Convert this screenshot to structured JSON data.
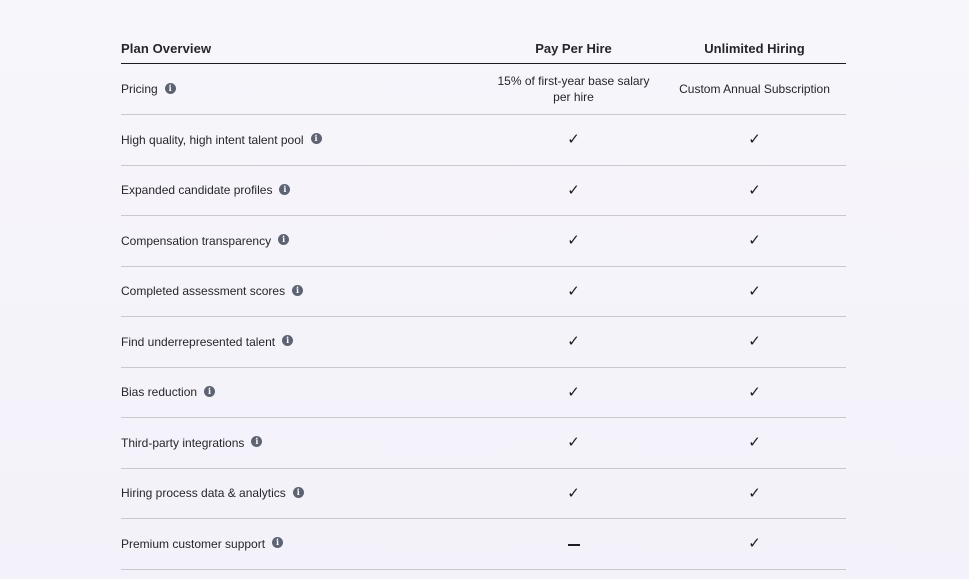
{
  "header": {
    "feature_label": "Plan Overview",
    "plan_a": "Pay Per Hire",
    "plan_b": "Unlimited Hiring"
  },
  "rows": [
    {
      "feature": "Pricing",
      "plan_a": "15% of first-year base salary per hire",
      "plan_b": "Custom Annual Subscription"
    },
    {
      "feature": "High quality, high intent talent pool",
      "plan_a": "✓",
      "plan_b": "✓"
    },
    {
      "feature": "Expanded candidate profiles",
      "plan_a": "✓",
      "plan_b": "✓"
    },
    {
      "feature": "Compensation transparency",
      "plan_a": "✓",
      "plan_b": "✓"
    },
    {
      "feature": "Completed assessment scores",
      "plan_a": "✓",
      "plan_b": "✓"
    },
    {
      "feature": "Find underrepresented talent",
      "plan_a": "✓",
      "plan_b": "✓"
    },
    {
      "feature": "Bias reduction",
      "plan_a": "✓",
      "plan_b": "✓"
    },
    {
      "feature": "Third-party integrations",
      "plan_a": "✓",
      "plan_b": "✓"
    },
    {
      "feature": "Hiring process data & analytics",
      "plan_a": "✓",
      "plan_b": "✓"
    },
    {
      "feature": "Premium customer support",
      "plan_a": "–",
      "plan_b": "✓"
    }
  ],
  "icons": {
    "info": "info-icon",
    "check": "check-icon",
    "dash": "dash-icon"
  },
  "colors": {
    "background": "#f5f4fa",
    "text": "#1d1d1f",
    "info_icon": "#5e6374",
    "divider": "#c9c8cf"
  }
}
